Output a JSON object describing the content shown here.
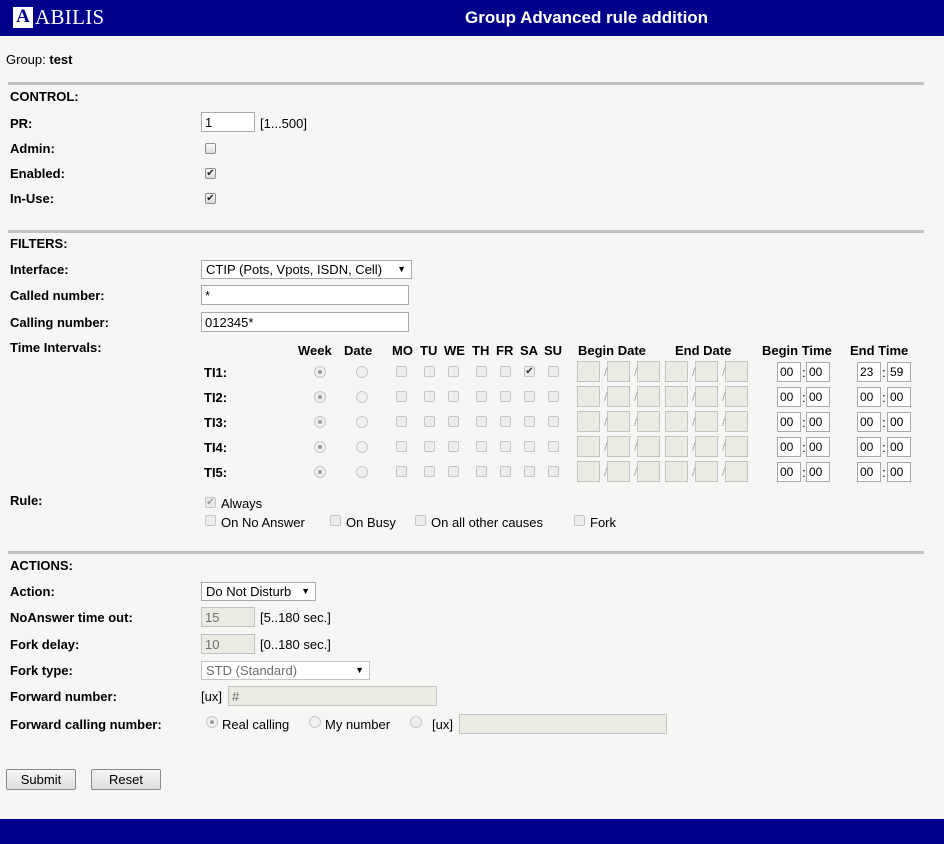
{
  "header": {
    "logo_letter": "A",
    "logo_text": "ABILIS",
    "title": "Group Advanced rule addition"
  },
  "group": {
    "label": "Group:",
    "value": "test"
  },
  "control": {
    "section": "CONTROL:",
    "pr_label": "PR:",
    "pr_value": "1",
    "pr_range": "[1...500]",
    "admin_label": "Admin:",
    "admin_checked": false,
    "enabled_label": "Enabled:",
    "enabled_checked": true,
    "inuse_label": "In-Use:",
    "inuse_checked": true
  },
  "filters": {
    "section": "FILTERS:",
    "interface_label": "Interface:",
    "interface_value": "CTIP (Pots, Vpots, ISDN, Cell)",
    "called_label": "Called number:",
    "called_value": "*",
    "calling_label": "Calling number:",
    "calling_value": "012345*",
    "ti_label": "Time Intervals:",
    "headers": {
      "week": "Week",
      "date": "Date",
      "days": [
        "MO",
        "TU",
        "WE",
        "TH",
        "FR",
        "SA",
        "SU"
      ],
      "begin_date": "Begin Date",
      "end_date": "End Date",
      "begin_time": "Begin Time",
      "end_time": "End Time"
    },
    "intervals": [
      {
        "label": "TI1:",
        "mode": "week",
        "days": [
          false,
          false,
          false,
          false,
          false,
          true,
          false
        ],
        "bh": "00",
        "bm": "00",
        "eh": "23",
        "em": "59"
      },
      {
        "label": "TI2:",
        "mode": "week",
        "days": [
          false,
          false,
          false,
          false,
          false,
          false,
          false
        ],
        "bh": "00",
        "bm": "00",
        "eh": "00",
        "em": "00"
      },
      {
        "label": "TI3:",
        "mode": "week",
        "days": [
          false,
          false,
          false,
          false,
          false,
          false,
          false
        ],
        "bh": "00",
        "bm": "00",
        "eh": "00",
        "em": "00"
      },
      {
        "label": "TI4:",
        "mode": "week",
        "days": [
          false,
          false,
          false,
          false,
          false,
          false,
          false
        ],
        "bh": "00",
        "bm": "00",
        "eh": "00",
        "em": "00"
      },
      {
        "label": "TI5:",
        "mode": "week",
        "days": [
          false,
          false,
          false,
          false,
          false,
          false,
          false
        ],
        "bh": "00",
        "bm": "00",
        "eh": "00",
        "em": "00"
      }
    ],
    "rule_label": "Rule:",
    "rule_always": "Always",
    "rule_always_checked": true,
    "rule_noanswer": "On No Answer",
    "rule_busy": "On Busy",
    "rule_other": "On all other causes",
    "rule_fork": "Fork"
  },
  "actions": {
    "section": "ACTIONS:",
    "action_label": "Action:",
    "action_value": "Do Not Disturb",
    "noanswer_label": "NoAnswer time out:",
    "noanswer_value": "15",
    "noanswer_range": "[5..180 sec.]",
    "forkdelay_label": "Fork delay:",
    "forkdelay_value": "10",
    "forkdelay_range": "[0..180 sec.]",
    "forktype_label": "Fork type:",
    "forktype_value": "STD (Standard)",
    "fwd_label": "Forward number:",
    "fwd_prefix": "[ux]",
    "fwd_value": "#",
    "fwdcalling_label": "Forward calling number:",
    "fwdcalling_real": "Real calling",
    "fwdcalling_my": "My number",
    "fwdcalling_prefix": "[ux]",
    "fwdcalling_value": ""
  },
  "buttons": {
    "submit": "Submit",
    "reset": "Reset"
  },
  "colors": {
    "header_bg": "#00008b",
    "page_bg": "#f6f6f4",
    "disabled_bg": "#ebebe4"
  }
}
